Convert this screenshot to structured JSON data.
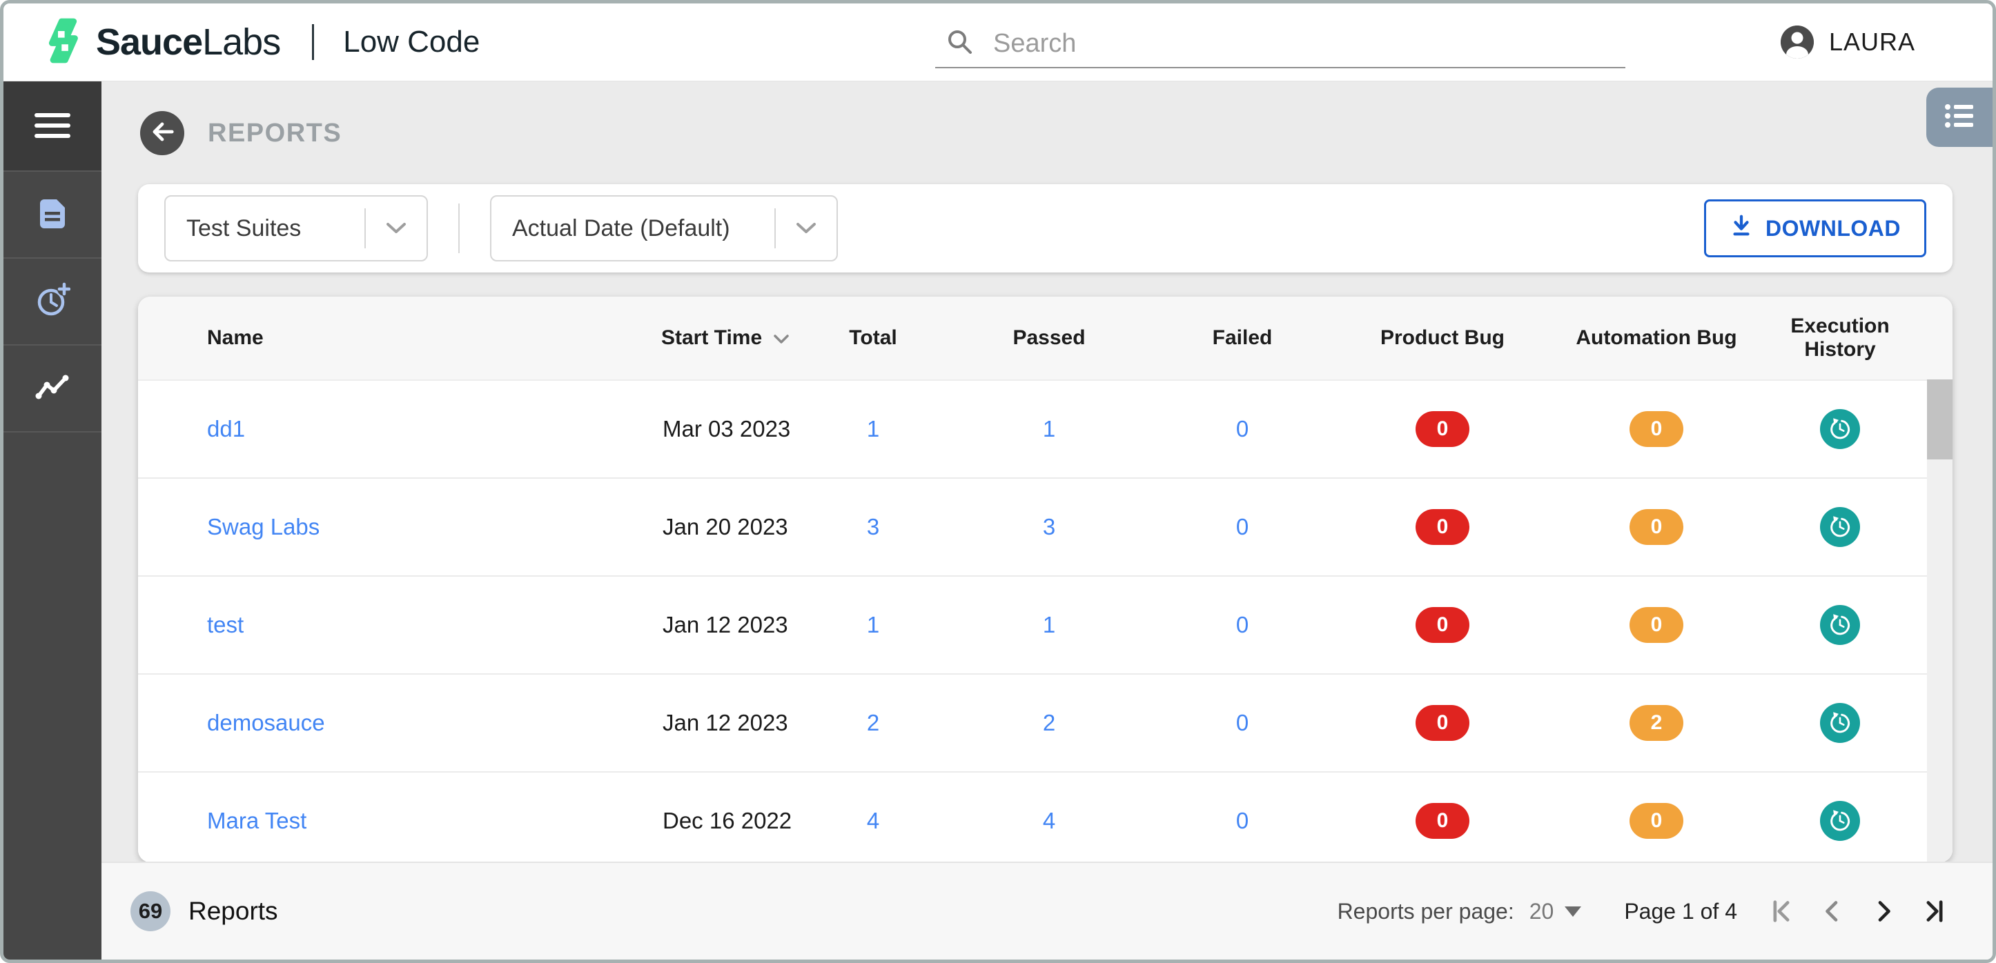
{
  "header": {
    "brand": {
      "name_bold": "Sauce",
      "name_regular": "Labs",
      "product": "Low Code"
    },
    "search": {
      "placeholder": "Search"
    },
    "user": {
      "name": "LAURA"
    }
  },
  "sidebar": {
    "items": [
      {
        "icon": "hamburger-menu-icon"
      },
      {
        "icon": "document-icon"
      },
      {
        "icon": "clock-add-icon"
      },
      {
        "icon": "trend-line-icon",
        "active": true
      }
    ]
  },
  "page": {
    "title": "REPORTS"
  },
  "filters": {
    "suite_dropdown": {
      "value": "Test Suites"
    },
    "date_dropdown": {
      "value": "Actual Date (Default)"
    },
    "download_button": "DOWNLOAD"
  },
  "table": {
    "columns": [
      "Name",
      "Start Time",
      "Total",
      "Passed",
      "Failed",
      "Product Bug",
      "Automation Bug",
      "Execution History"
    ],
    "rows": [
      {
        "name": "dd1",
        "start_time": "Mar 03 2023",
        "total": "1",
        "passed": "1",
        "failed": "0",
        "product_bug": "0",
        "automation_bug": "0"
      },
      {
        "name": "Swag Labs",
        "start_time": "Jan 20 2023",
        "total": "3",
        "passed": "3",
        "failed": "0",
        "product_bug": "0",
        "automation_bug": "0"
      },
      {
        "name": "test",
        "start_time": "Jan 12 2023",
        "total": "1",
        "passed": "1",
        "failed": "0",
        "product_bug": "0",
        "automation_bug": "0"
      },
      {
        "name": "demosauce",
        "start_time": "Jan 12 2023",
        "total": "2",
        "passed": "2",
        "failed": "0",
        "product_bug": "0",
        "automation_bug": "2"
      },
      {
        "name": "Mara Test",
        "start_time": "Dec 16 2022",
        "total": "4",
        "passed": "4",
        "failed": "0",
        "product_bug": "0",
        "automation_bug": "0"
      }
    ]
  },
  "footer": {
    "report_count": "69",
    "report_count_label": "Reports",
    "per_page_label": "Reports per page:",
    "per_page_value": "20",
    "page_info": "Page 1 of 4"
  },
  "icons": {
    "search": "magnifier",
    "avatar": "person-silhouette",
    "back": "arrow-left-circle",
    "sort": "chevron-down",
    "download": "arrow-down-tray",
    "execution_history": "clock-restore",
    "view_toggle": "bulleted-list",
    "pagination": [
      "first-page",
      "previous-page",
      "next-page",
      "last-page"
    ]
  },
  "colors": {
    "brand_green": "#3ddc91",
    "link_blue": "#4285f4",
    "product_bug_red": "#e02420",
    "automation_bug_orange": "#f2a33b",
    "history_teal": "#18a19c",
    "download_blue": "#1a5fd0",
    "sidebar_dark": "#474747",
    "sidebar_icon_blue": "#a9c2ee"
  }
}
